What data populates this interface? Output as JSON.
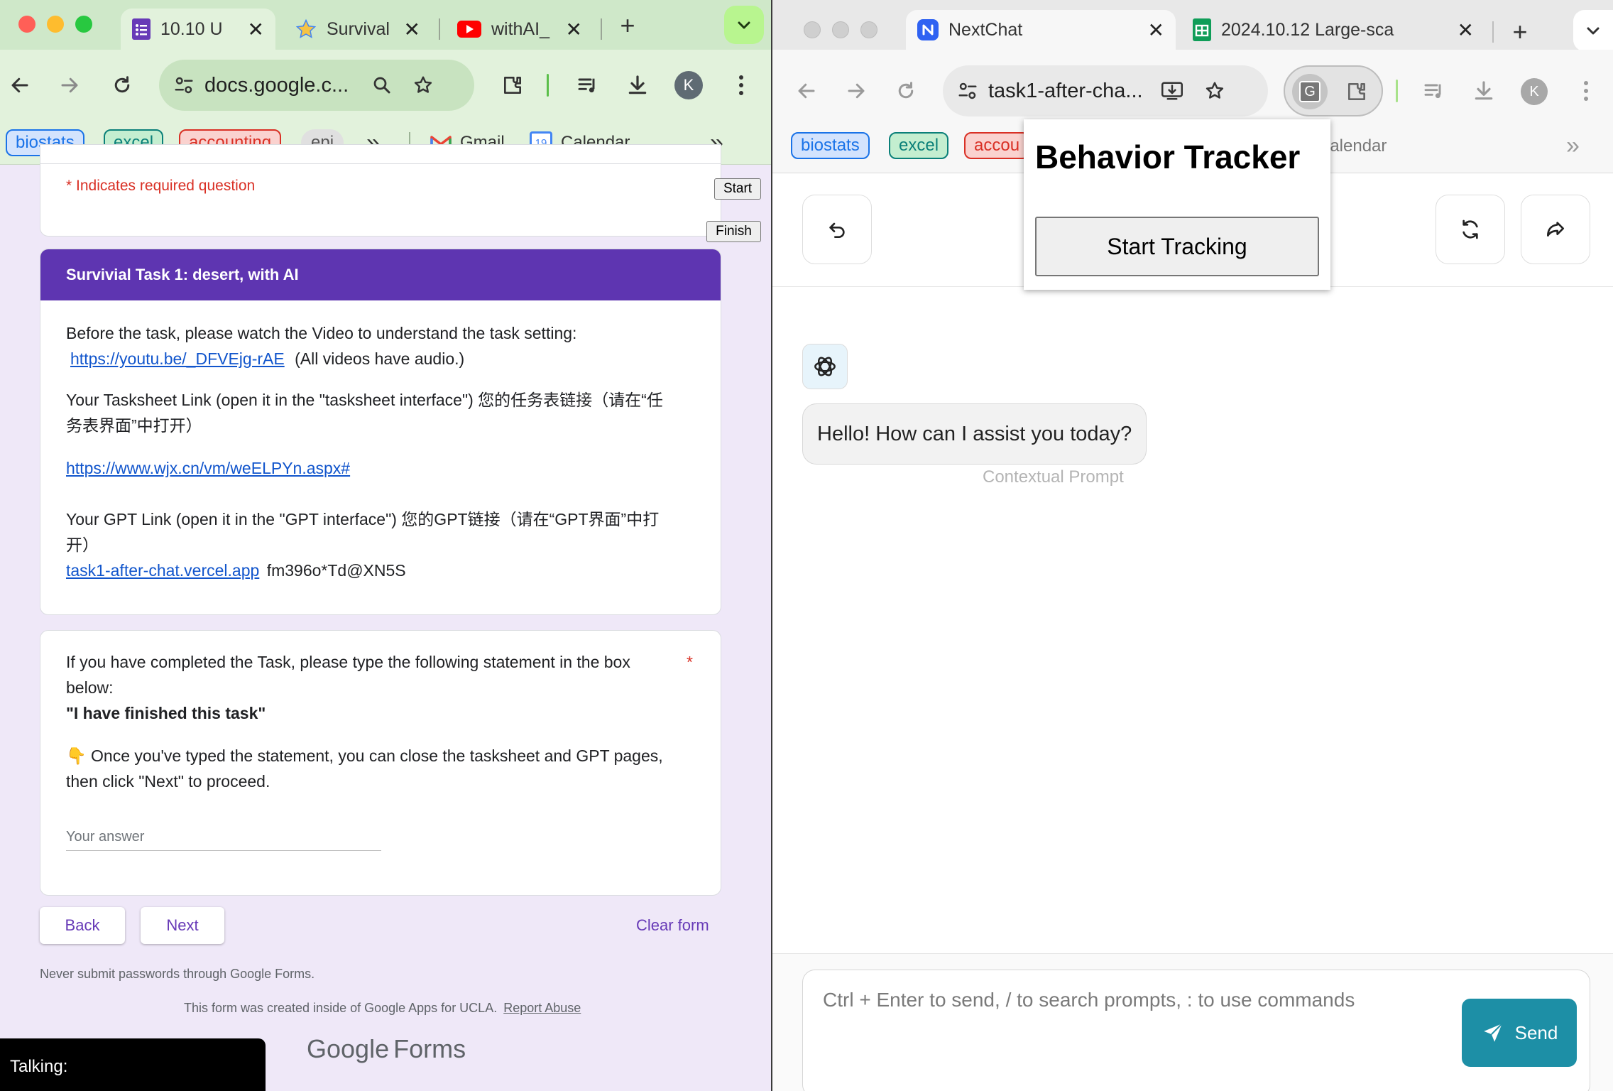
{
  "left_window": {
    "tabs": [
      {
        "title": "10.10 U",
        "icon": "google-forms-icon",
        "active": true
      },
      {
        "title": "Survival",
        "icon": "star-icon",
        "active": false
      },
      {
        "title": "withAI_",
        "icon": "youtube-icon",
        "active": false
      }
    ],
    "new_tab": "+",
    "tab_close": "✕",
    "address": "docs.google.c...",
    "avatar_letter": "K",
    "bookmarks": [
      {
        "label": "biostats",
        "color": "#1a73e8",
        "bg": "#d3e3fd"
      },
      {
        "label": "excel",
        "color": "#0b8079",
        "bg": "#c4eed0"
      },
      {
        "label": "accounting",
        "color": "#d93025",
        "bg": "#fad2cf"
      },
      {
        "label": "epi",
        "color": "#555555",
        "bg": "#e0e0e0"
      }
    ],
    "bookmark_overflow": "»",
    "bookmark_gmail": "Gmail",
    "bookmark_calendar": "Calendar",
    "calendar_day": "19"
  },
  "form": {
    "required_note": "* Indicates required question",
    "start_button": "Start",
    "finish_button": "Finish",
    "section_title": "Survivial Task 1: desert, with AI",
    "video_intro": "Before the task, please watch the Video to understand the task setting:",
    "video_link": "https://youtu.be/_DFVEjg-rAE",
    "video_note": "(All videos have audio.)",
    "tasksheet_line1": "Your Tasksheet Link (open it in the \"tasksheet interface\") 您的任务表链接（请在“任",
    "tasksheet_line2": "务表界面”中打开）",
    "tasksheet_link": "https://www.wjx.cn/vm/weELPYn.aspx#",
    "gpt_line1": "Your GPT Link (open it in the \"GPT interface\") 您的GPT链接（请在“GPT界面”中打",
    "gpt_line2": "开）",
    "gpt_link": "task1-after-chat.vercel.app",
    "gpt_password": "fm396o*Td@XN5S",
    "question_line1": "If you have completed the Task, please type the following statement in the box",
    "question_line2": "below:",
    "required_star": "*",
    "statement": "\"I have finished this task\"",
    "instruction_line1": "👇 Once you've typed the statement, you can close the tasksheet and GPT pages,",
    "instruction_line2": "then click \"Next\" to proceed.",
    "answer_placeholder": "Your answer",
    "back_button": "Back",
    "next_button": "Next",
    "clear_button": "Clear form",
    "password_warning": "Never submit passwords through Google Forms.",
    "footer_text": "This form was created inside of Google Apps for UCLA.",
    "report_abuse": "Report Abuse",
    "logo_google": "Google",
    "logo_forms": "Forms"
  },
  "talking_overlay": {
    "label": "Talking:"
  },
  "right_window": {
    "tabs": [
      {
        "title": "NextChat",
        "icon": "nextchat-icon",
        "active": true
      },
      {
        "title": "2024.10.12 Large-sca",
        "icon": "google-sheets-icon",
        "active": false
      }
    ],
    "new_tab": "+",
    "tab_close": "✕",
    "address": "task1-after-cha...",
    "extension_letter": "G",
    "avatar_letter": "K",
    "bookmarks": [
      {
        "label": "biostats",
        "color": "#1a73e8",
        "bg": "#d3e3fd"
      },
      {
        "label": "excel",
        "color": "#0b8079",
        "bg": "#c4eed0"
      },
      {
        "label": "accou",
        "color": "#d93025",
        "bg": "#fad2cf"
      }
    ],
    "bookmark_calendar": "Calendar",
    "bookmark_overflow": "»"
  },
  "behavior_tracker": {
    "title": "Behavior Tracker",
    "start_button": "Start Tracking"
  },
  "chat": {
    "greeting": "Hello! How can I assist you today?",
    "contextual_prompt": "Contextual Prompt",
    "input_placeholder": "Ctrl + Enter to send, / to search prompts, : to use commands",
    "send_button": "Send"
  }
}
